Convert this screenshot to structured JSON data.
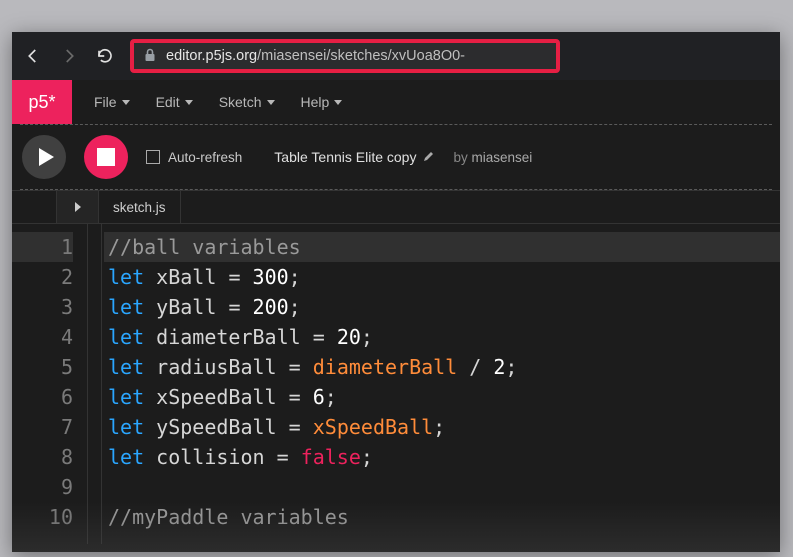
{
  "browser": {
    "url_domain": "editor.p5js.org",
    "url_path": "/miasensei/sketches/xvUoa8O0-"
  },
  "logo": "p5*",
  "menus": [
    "File",
    "Edit",
    "Sketch",
    "Help"
  ],
  "toolbar": {
    "auto_refresh": "Auto-refresh",
    "sketch_name": "Table Tennis Elite copy",
    "by": "by",
    "author": "miasensei"
  },
  "file_tab": "sketch.js",
  "code": {
    "lines": [
      {
        "n": "1",
        "t": "comment",
        "text": "//ball variables"
      },
      {
        "n": "2",
        "t": "decl",
        "ident": "xBall",
        "op": "=",
        "val": "300",
        "vtype": "num"
      },
      {
        "n": "3",
        "t": "decl",
        "ident": "yBall",
        "op": "=",
        "val": "200",
        "vtype": "num"
      },
      {
        "n": "4",
        "t": "decl",
        "ident": "diameterBall",
        "op": "=",
        "val": "20",
        "vtype": "num"
      },
      {
        "n": "5",
        "t": "decl",
        "ident": "radiusBall",
        "op": "=",
        "val": "diameterBall / 2",
        "vtype": "expr"
      },
      {
        "n": "6",
        "t": "decl",
        "ident": "xSpeedBall",
        "op": "=",
        "val": "6",
        "vtype": "num"
      },
      {
        "n": "7",
        "t": "decl",
        "ident": "ySpeedBall",
        "op": "=",
        "val": "xSpeedBall",
        "vtype": "var"
      },
      {
        "n": "8",
        "t": "decl",
        "ident": "collision",
        "op": "=",
        "val": "false",
        "vtype": "bool"
      },
      {
        "n": "9",
        "t": "blank",
        "text": ""
      },
      {
        "n": "10",
        "t": "comment",
        "text": "//myPaddle variables"
      }
    ]
  }
}
